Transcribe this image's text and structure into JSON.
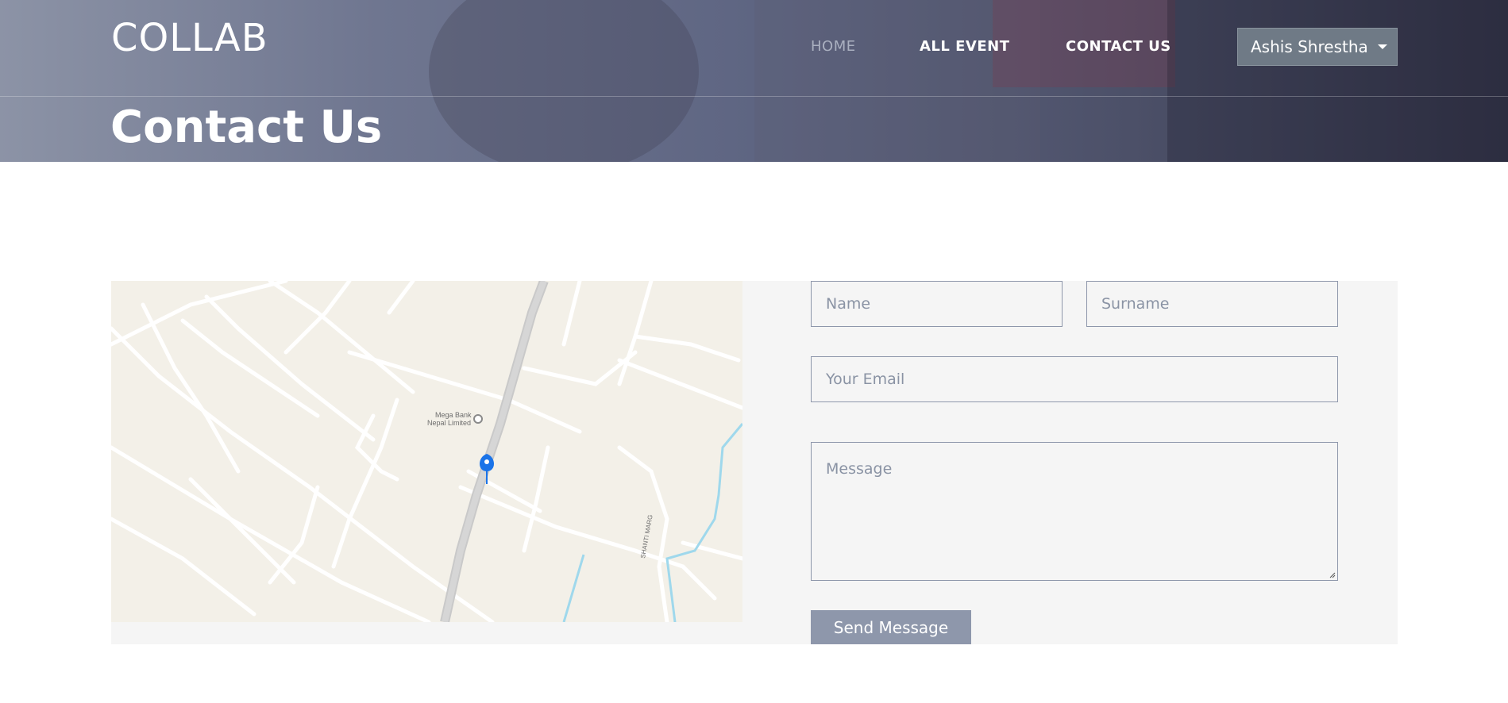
{
  "header": {
    "logo": "COLLAB",
    "nav": {
      "home": "HOME",
      "all_event": "ALL EVENT",
      "contact_us": "CONTACT US"
    },
    "user_menu_label": "Ashis Shrestha",
    "page_title": "Contact Us"
  },
  "map": {
    "poi_label_line1": "Mega Bank",
    "poi_label_line2": "Nepal Limited",
    "road_label": "SHANTI MARG",
    "marker_icon": "location-pin-icon"
  },
  "form": {
    "name_placeholder": "Name",
    "surname_placeholder": "Surname",
    "email_placeholder": "Your Email",
    "message_placeholder": "Message",
    "submit_label": "Send Message"
  },
  "colors": {
    "hero_start": "#8c93a6",
    "hero_end": "#35364a",
    "field_border": "#8e97ab",
    "button_bg": "#8e97ab",
    "user_button_bg": "#6f7a86",
    "map_marker": "#1a73e8"
  }
}
